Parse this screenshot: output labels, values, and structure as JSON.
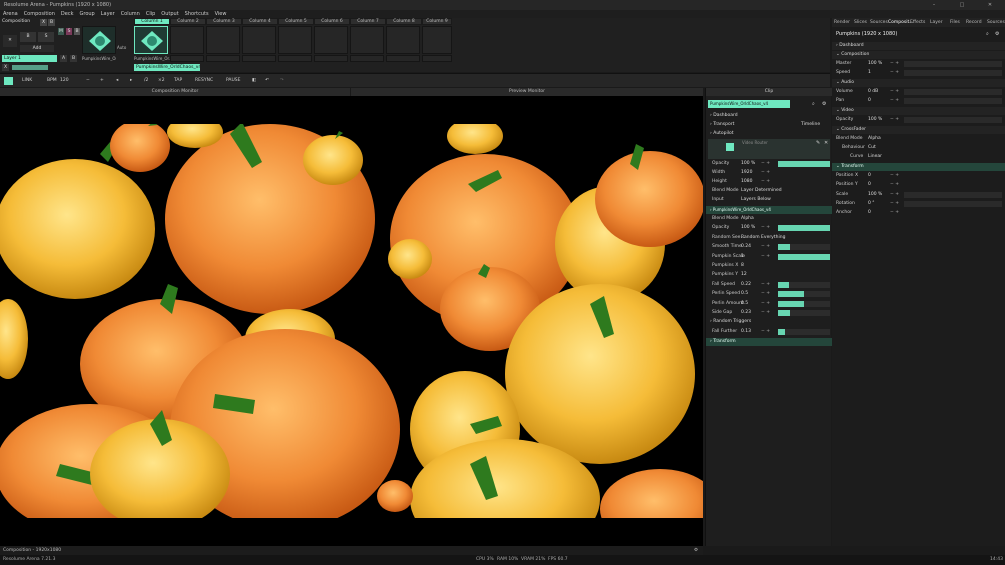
{
  "app": {
    "title": "Resolume Arena - Pumpkins (1920 x 1080)"
  },
  "window_controls": {
    "minimize": "–",
    "maximize": "□",
    "close": "✕"
  },
  "menu": [
    "Arena",
    "Composition",
    "Deck",
    "Group",
    "Layer",
    "Column",
    "Clip",
    "Output",
    "Shortcuts",
    "View"
  ],
  "deck": {
    "composition_label": "Composition",
    "columns": [
      "Column 1",
      "Column 2",
      "Column 3",
      "Column 4",
      "Column 5",
      "Column 6",
      "Column 7",
      "Column 8",
      "Column 9"
    ],
    "add_label": "Add",
    "layer_name": "Layer 1",
    "clip_name": "PumpkinsWire_Or...",
    "clip_name_full": "PumpkinsWire_OrldChaos_v4",
    "auto_label": "Auto"
  },
  "transport": {
    "link": "LINK",
    "bpm_label": "BPM",
    "bpm": "120",
    "minus": "−",
    "plus": "+",
    "half": "/2",
    "double": "×2",
    "tap": "TAP",
    "resync": "RESYNC",
    "pause": "PAUSE"
  },
  "monitors": {
    "composition": "Composition Monitor",
    "preview": "Preview Monitor"
  },
  "status": {
    "composition": "Composition - 1920x1080",
    "version": "Resolume Arena 7.21.3",
    "cpu": "CPU 3%",
    "ram": "RAM 10%",
    "vram": "VRAM 21%",
    "fps": "FPS 60.7",
    "time": "14:43"
  },
  "clip_panel": {
    "header": "Clip",
    "name": "PumpkinsWire_OrldChaos_v4",
    "dashboard": "Dashboard",
    "transport": "Transport",
    "transport_val": "Timeline",
    "autopilot": "Autopilot",
    "video_router": "Video Router",
    "router_rows": [
      {
        "label": "Opacity",
        "value": "100 %",
        "fill": 1.0
      },
      {
        "label": "Width",
        "value": "1920"
      },
      {
        "label": "Height",
        "value": "1080"
      },
      {
        "label": "Blend Mode",
        "value": "Layer Determined"
      },
      {
        "label": "Input",
        "value": "Layers Below"
      }
    ],
    "effect_name": "PumpkinsWire_OrldChaos_v4",
    "effect_rows": [
      {
        "label": "Blend Mode",
        "value": "Alpha"
      },
      {
        "label": "Opacity",
        "value": "100 %",
        "fill": 1.0
      },
      {
        "label": "Random See...",
        "value": "Random Everything"
      },
      {
        "label": "Smooth Time",
        "value": "0.24",
        "fill": 0.24
      },
      {
        "label": "Pumpkin Scale",
        "value": "1",
        "fill": 1.0
      },
      {
        "label": "Pumpkins X",
        "value": "8"
      },
      {
        "label": "Pumpkins Y",
        "value": "12"
      },
      {
        "label": "Fall Speed",
        "value": "0.22",
        "fill": 0.22
      },
      {
        "label": "Perlin Speed",
        "value": "0.5",
        "fill": 0.5
      },
      {
        "label": "Perlin Amount",
        "value": "0.5",
        "fill": 0.5
      },
      {
        "label": "Side Gap",
        "value": "0.23",
        "fill": 0.23
      }
    ],
    "random_triggers": "Random Triggers",
    "fall_further": {
      "label": "Fall Further",
      "value": "0.13",
      "fill": 0.13
    },
    "transform": "Transform"
  },
  "right_panel": {
    "tabs": [
      "Render",
      "Slices",
      "Sources",
      "Composit...",
      "Effects",
      "Layer",
      "Files",
      "Record",
      "Sources"
    ],
    "title": "Pumpkins (1920 x 1080)",
    "dashboard": "Dashboard",
    "composition": "Composition",
    "master": {
      "label": "Master",
      "value": "100 %"
    },
    "speed": {
      "label": "Speed",
      "value": "1"
    },
    "audio": "Audio",
    "volume": {
      "label": "Volume",
      "value": "0 dB"
    },
    "pan": {
      "label": "Pan",
      "value": "0"
    },
    "video": "Video",
    "opacity": {
      "label": "Opacity",
      "value": "100 %"
    },
    "crossfader": "CrossFader",
    "blend_mode": {
      "label": "Blend Mode",
      "value": "Alpha"
    },
    "behaviour": {
      "label": "Behaviour",
      "value": "Cut"
    },
    "curve": {
      "label": "Curve",
      "value": "Linear"
    },
    "transform": "Transform",
    "position_x": {
      "label": "Position X",
      "value": "0"
    },
    "position_y": {
      "label": "Position Y",
      "value": "0"
    },
    "scale": {
      "label": "Scale",
      "value": "100 %"
    },
    "rotation": {
      "label": "Rotation",
      "value": "0 °"
    },
    "anchor": {
      "label": "Anchor",
      "value": "0"
    }
  },
  "colors": {
    "accent": "#6ee8c0",
    "panel": "#1e1e1e",
    "section": "#24463b"
  }
}
